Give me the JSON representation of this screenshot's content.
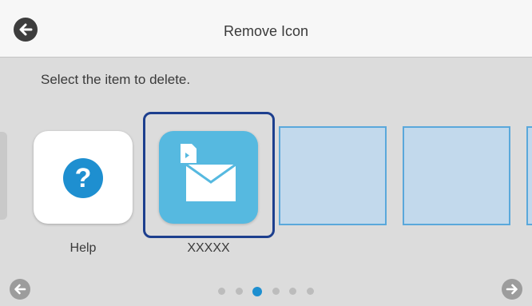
{
  "header": {
    "title": "Remove Icon",
    "back_icon": "arrow-left-circle-icon"
  },
  "instruction": "Select the item to delete.",
  "items": [
    {
      "label": "Help",
      "icon": "help-question-icon",
      "color": "#1e8fd0",
      "selected": false
    },
    {
      "label": "XXXXX",
      "icon": "scan-to-email-icon",
      "color": "#56b9e0",
      "selected": true
    }
  ],
  "empty_slots": 3,
  "pagination": {
    "page_count": 6,
    "current_page": 3,
    "prev_icon": "arrow-left-circle-icon",
    "next_icon": "arrow-right-circle-icon"
  },
  "colors": {
    "selection_border": "#1d3f8e",
    "slot_fill": "#c2d9ec",
    "slot_border": "#5aa8db",
    "accent": "#1e8fd0"
  }
}
